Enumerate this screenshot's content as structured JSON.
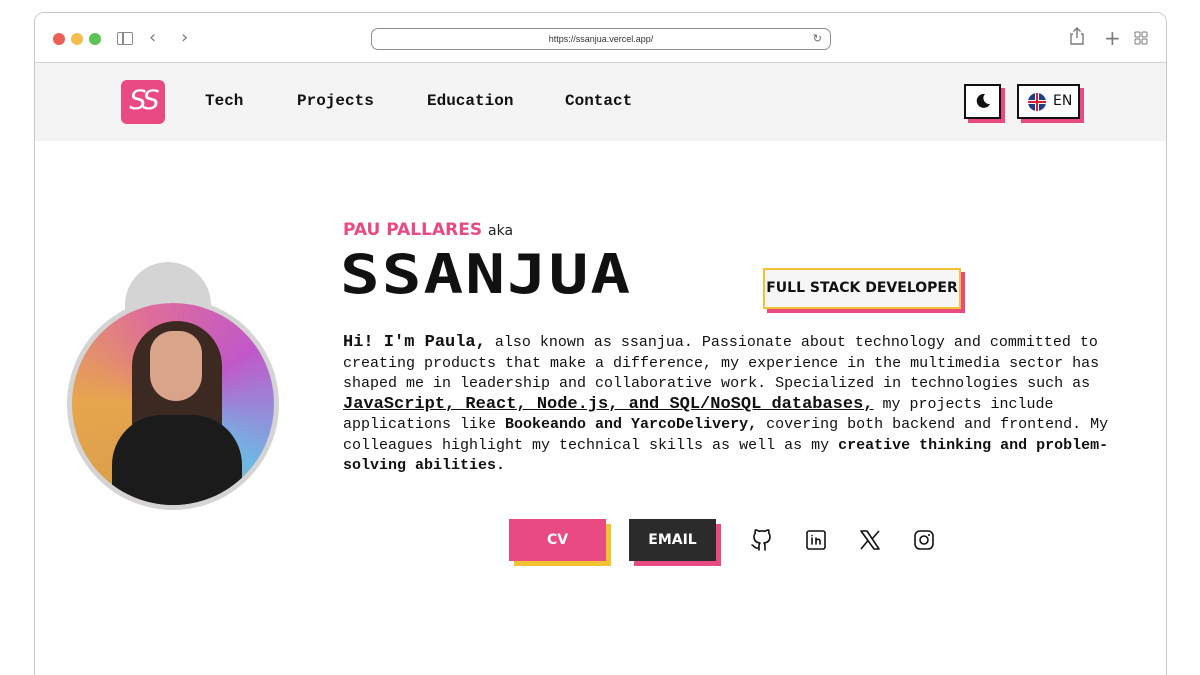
{
  "browser": {
    "url": "https://ssanjua.vercel.app/"
  },
  "nav": {
    "logo_text": "SS",
    "links": [
      "Tech",
      "Projects",
      "Education",
      "Contact"
    ],
    "theme_icon": "moon-icon",
    "language": "EN"
  },
  "hero": {
    "name": "PAU PALLARES",
    "aka": "aka",
    "alias": "SSANJUA",
    "role": "FULL STACK DEVELOPER",
    "bio": {
      "greeting": "Hi! I'm Paula,",
      "part1": " also known as ssanjua. Passionate about technology and committed to creating products that make a difference, my experience in the multimedia sector has shaped me in leadership and collaborative work. Specialized in technologies such as ",
      "tech": "JavaScript, React, Node.js, and SQL/NoSQL databases,",
      "part2": " my projects include applications like ",
      "projects": "Bookeando and YarcoDelivery,",
      "part3": " covering both backend and frontend. My colleagues highlight my technical skills as well as my ",
      "closing": "creative thinking and problem-solving abilities."
    },
    "cv_label": "CV",
    "email_label": "EMAIL",
    "socials": [
      "github-icon",
      "linkedin-icon",
      "x-icon",
      "instagram-icon"
    ]
  },
  "colors": {
    "accent": "#e94a82",
    "secondary": "#f1c232",
    "dark": "#2b2b2b"
  }
}
